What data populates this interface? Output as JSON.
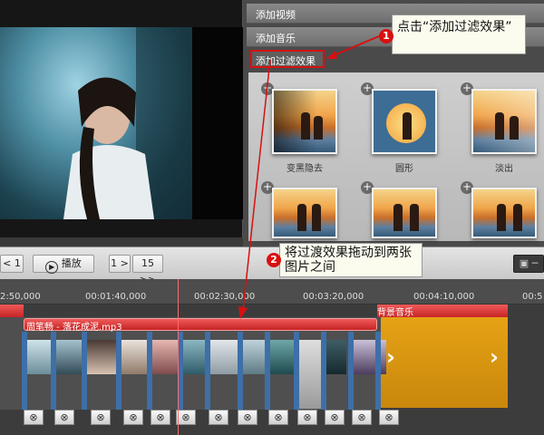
{
  "right_panel": {
    "tabs": [
      "添加视频",
      "添加音乐"
    ],
    "active_tab": "添加过滤效果",
    "transitions": [
      {
        "label": "变黑隐去"
      },
      {
        "label": "圆形"
      },
      {
        "label": "淡出"
      },
      {
        "label": ""
      },
      {
        "label": ""
      },
      {
        "label": ""
      }
    ]
  },
  "callouts": {
    "step1": {
      "num": "1",
      "text": "点击“添加过滤效果”"
    },
    "step2": {
      "num": "2",
      "text": "将过渡效果拖动到两张图片之间"
    }
  },
  "controls": {
    "prev": "< 1",
    "play": "播放",
    "next": "1 >",
    "end": "15 >>"
  },
  "ruler": {
    "labels": [
      "2:50,000",
      "00:01:40,000",
      "00:02:30,000",
      "00:03:20,000",
      "00:04:10,000",
      "00:5"
    ]
  },
  "timeline": {
    "music_track": "周笔畅 - 落花成泥.mp3",
    "bg_music": "背景音乐",
    "remove_icon": "⊗"
  },
  "colors": {
    "accent_red": "#d81010",
    "track_orange": "#e5a215",
    "transition_blue": "#3e6fa8"
  }
}
